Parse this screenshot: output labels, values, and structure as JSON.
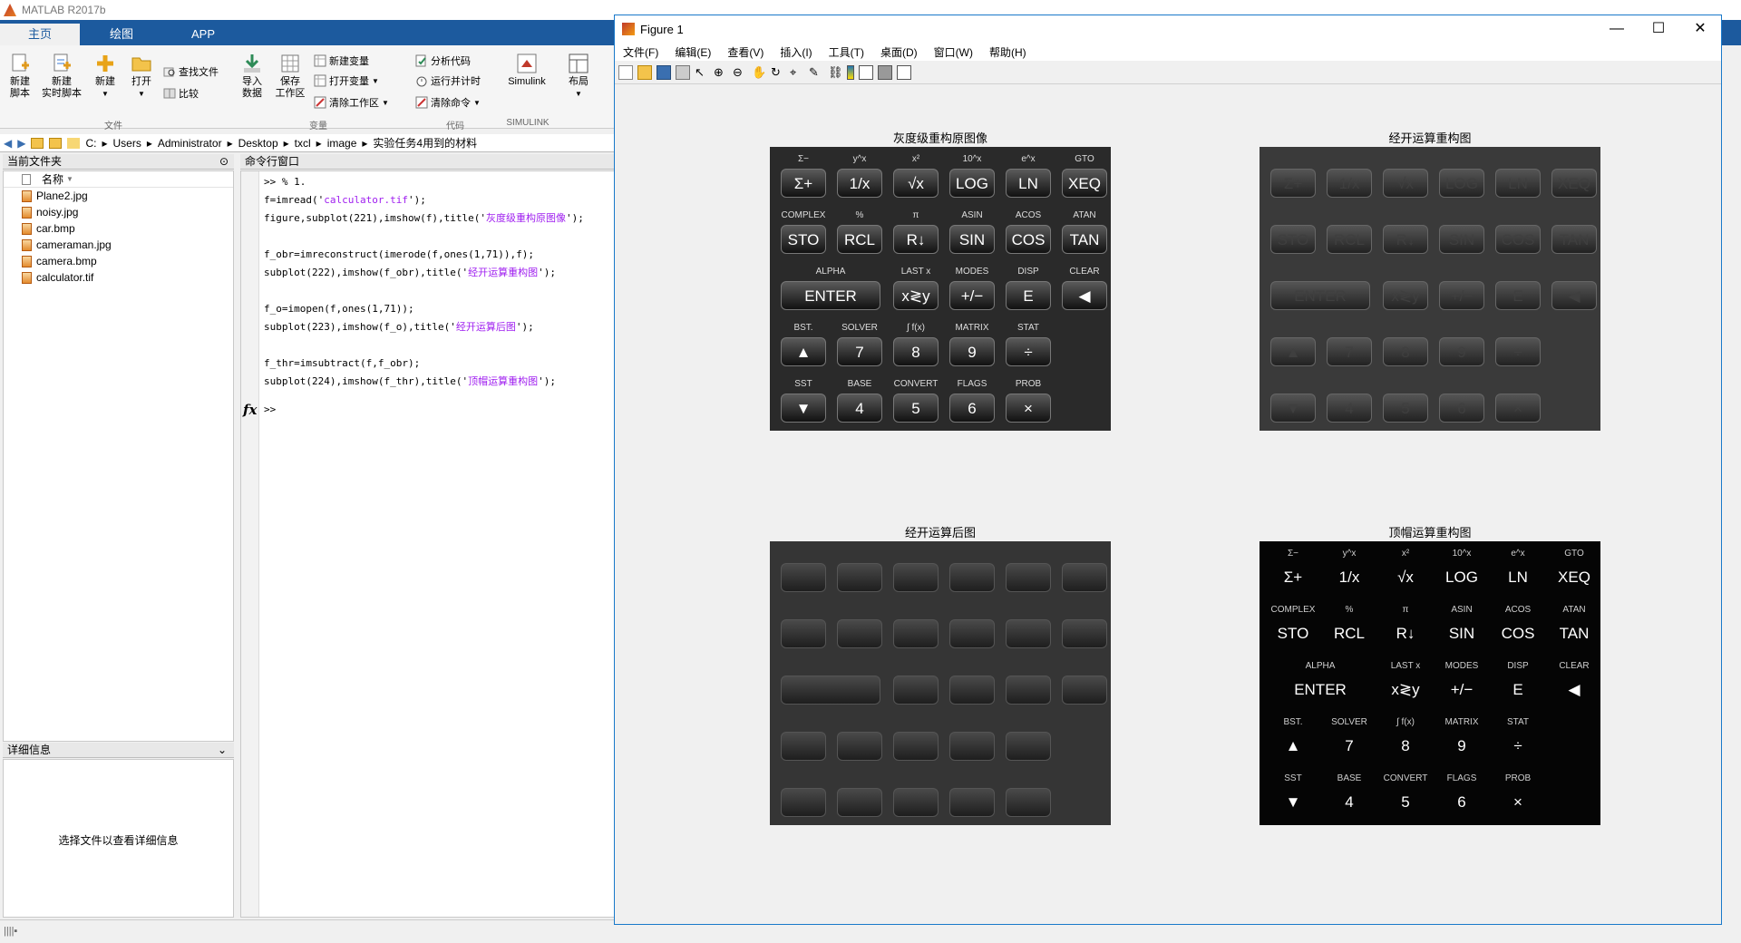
{
  "app": {
    "title": "MATLAB R2017b"
  },
  "main_tabs": [
    {
      "label": "主页"
    },
    {
      "label": "绘图"
    },
    {
      "label": "APP"
    }
  ],
  "ribbon": {
    "new_script": "新建\n脚本",
    "new_live_script": "新建\n实时脚本",
    "new": "新建",
    "open": "打开",
    "find_files": "查找文件",
    "compare": "比较",
    "import_data": "导入\n数据",
    "save_workspace": "保存\n工作区",
    "new_variable": "新建变量",
    "open_variable": "打开变量",
    "clear_workspace": "清除工作区",
    "analyze_code": "分析代码",
    "run_and_time": "运行并计时",
    "clear_commands": "清除命令",
    "simulink": "Simulink",
    "layout": "布局",
    "groups": {
      "file": "文件",
      "variable": "变量",
      "code": "代码",
      "simulink": "SIMULINK"
    }
  },
  "address": {
    "parts": [
      "C:",
      "Users",
      "Administrator",
      "Desktop",
      "txcl",
      "image",
      "实验任务4用到的材料"
    ]
  },
  "current_folder": {
    "title": "当前文件夹",
    "column": "名称",
    "files": [
      {
        "name": "Plane2.jpg",
        "type": "img"
      },
      {
        "name": "noisy.jpg",
        "type": "img"
      },
      {
        "name": "car.bmp",
        "type": "img"
      },
      {
        "name": "cameraman.jpg",
        "type": "img"
      },
      {
        "name": "camera.bmp",
        "type": "img"
      },
      {
        "name": "calculator.tif",
        "type": "img"
      }
    ]
  },
  "details": {
    "title": "详细信息",
    "message": "选择文件以查看详细信息"
  },
  "command_window": {
    "title": "命令行窗口",
    "prompt": ">>",
    "fx": "fx"
  },
  "figure": {
    "title": "Figure 1",
    "menu": [
      "文件(F)",
      "编辑(E)",
      "查看(V)",
      "插入(I)",
      "工具(T)",
      "桌面(D)",
      "窗口(W)",
      "帮助(H)"
    ],
    "subplots": [
      {
        "title": "灰度级重构原图像",
        "style": "orig"
      },
      {
        "title": "经开运算重构图",
        "style": "recon"
      },
      {
        "title": "经开运算后图",
        "style": "open"
      },
      {
        "title": "顶帽运算重构图",
        "style": "tophat"
      }
    ]
  },
  "calculator": {
    "rows": [
      {
        "labels": [
          "Σ−",
          "y^x",
          "x²",
          "10^x",
          "e^x",
          "GTO"
        ],
        "keys": [
          "Σ+",
          "1/x",
          "√x",
          "LOG",
          "LN",
          "XEQ"
        ]
      },
      {
        "labels": [
          "COMPLEX",
          "%",
          "π",
          "ASIN",
          "ACOS",
          "ATAN"
        ],
        "keys": [
          "STO",
          "RCL",
          "R↓",
          "SIN",
          "COS",
          "TAN"
        ]
      },
      {
        "labels": [
          "ALPHA",
          "LAST x",
          "MODES",
          "DISP",
          "CLEAR"
        ],
        "keys": [
          "ENTER",
          "x≷y",
          "+/−",
          "E",
          "◀"
        ]
      },
      {
        "labels": [
          "BST.",
          "SOLVER",
          "∫ f(x)",
          "MATRIX",
          "STAT"
        ],
        "keys": [
          "▲",
          "7",
          "8",
          "9",
          "÷"
        ]
      },
      {
        "labels": [
          "SST",
          "BASE",
          "CONVERT",
          "FLAGS",
          "PROB"
        ],
        "keys": [
          "▼",
          "4",
          "5",
          "6",
          "×"
        ]
      }
    ]
  }
}
